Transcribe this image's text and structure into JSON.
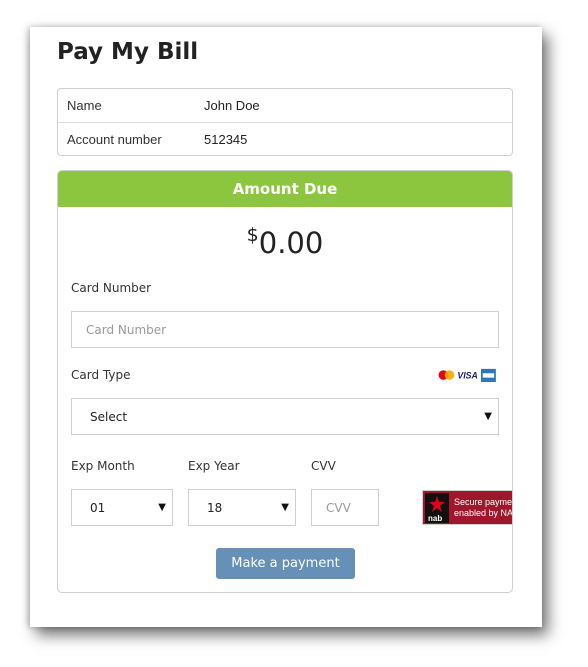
{
  "page": {
    "title": "Pay My Bill"
  },
  "account": {
    "name_label": "Name",
    "name_value": "John Doe",
    "number_label": "Account number",
    "number_value": "512345"
  },
  "payment": {
    "header": "Amount Due",
    "currency_symbol": "$",
    "amount": "0.00",
    "card_number_label": "Card Number",
    "card_number_placeholder": "Card Number",
    "card_type_label": "Card Type",
    "card_type_value": "Select",
    "card_type_icons": [
      "mastercard-icon",
      "visa-icon",
      "amex-icon"
    ],
    "visa_text": "VISA",
    "exp_month_label": "Exp Month",
    "exp_month_value": "01",
    "exp_year_label": "Exp Year",
    "exp_year_value": "18",
    "cvv_label": "CVV",
    "cvv_placeholder": "CVV",
    "nab_badge_line1": "Secure payments",
    "nab_badge_line2": "enabled by NAB",
    "nab_logo_text": "nab",
    "submit_label": "Make a payment"
  },
  "colors": {
    "header_green": "#8cc63f",
    "button_blue": "#6690b7",
    "nab_red": "#a0172c"
  }
}
